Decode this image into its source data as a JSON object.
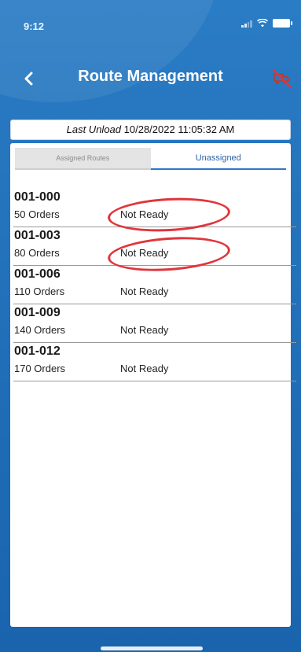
{
  "status_bar": {
    "time": "9:12",
    "icons": [
      "signal-icon",
      "wifi-icon",
      "battery-icon"
    ]
  },
  "nav": {
    "title": "Route Management",
    "back_icon": "chevron-left-icon",
    "action_icon": "truck-off-icon"
  },
  "last_unload": {
    "label": "Last Unload",
    "value": "10/28/2022 11:05:32 AM"
  },
  "tabs": [
    {
      "label": "Assigned Routes",
      "selected": false
    },
    {
      "label": "Unassigned",
      "selected": true
    }
  ],
  "routes": [
    {
      "id": "001-000",
      "orders": "50 Orders",
      "status": "Not Ready"
    },
    {
      "id": "001-003",
      "orders": "80 Orders",
      "status": "Not Ready"
    },
    {
      "id": "001-006",
      "orders": "110 Orders",
      "status": "Not Ready"
    },
    {
      "id": "001-009",
      "orders": "140 Orders",
      "status": "Not Ready"
    },
    {
      "id": "001-012",
      "orders": "170 Orders",
      "status": "Not Ready"
    }
  ],
  "colors": {
    "header_blue": "#2a7cc4",
    "tab_accent": "#2c78c9",
    "annotation_red": "#e0353b"
  }
}
